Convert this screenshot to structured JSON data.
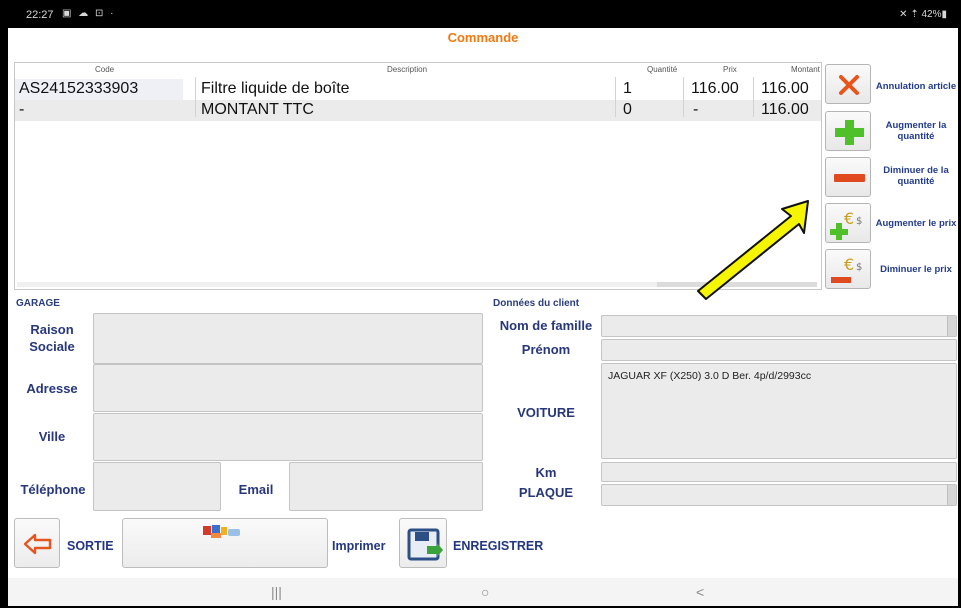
{
  "status_bar": {
    "time": "22:27",
    "left_icons": "▣ ☁ ⊡ ·",
    "right_text": "✕ ⇡ 42%▮"
  },
  "title": "Commande",
  "table": {
    "headers": {
      "code": "Code",
      "description": "Description",
      "quantity": "Quantité",
      "price": "Prix",
      "amount": "Montant"
    },
    "rows": [
      {
        "code": "AS24152333903",
        "description": "Filtre liquide de boîte",
        "quantity": "1",
        "price": "116.00",
        "amount": "116.00"
      },
      {
        "code": "-",
        "description": "MONTANT TTC",
        "quantity": "0",
        "price": "-",
        "amount": "116.00"
      }
    ]
  },
  "side_actions": {
    "cancel": "Annulation article",
    "increase_qty": "Augmenter la quantité",
    "decrease_qty": "Diminuer de la quantité",
    "increase_price": "Augmenter le prix",
    "decrease_price": "Diminuer le prix"
  },
  "garage": {
    "section": "GARAGE",
    "company_label": "Raison Sociale",
    "address_label": "Adresse",
    "city_label": "Ville",
    "phone_label": "Téléphone",
    "email_label": "Email"
  },
  "client": {
    "section": "Données du client",
    "lastname_label": "Nom de famille",
    "firstname_label": "Prénom",
    "car_label": "VOITURE",
    "car_value": "JAGUAR XF (X250) 3.0 D Ber. 4p/d/2993cc",
    "km_label": "Km",
    "plate_label": "PLAQUE"
  },
  "bottom": {
    "exit": "SORTIE",
    "print": "Imprimer",
    "save": "ENREGISTRER"
  },
  "nav": {
    "recent": "|||",
    "home": "○",
    "back": "<"
  },
  "colors": {
    "title": "#f07a12",
    "label": "#27377a",
    "arrow": "#f5f500"
  }
}
